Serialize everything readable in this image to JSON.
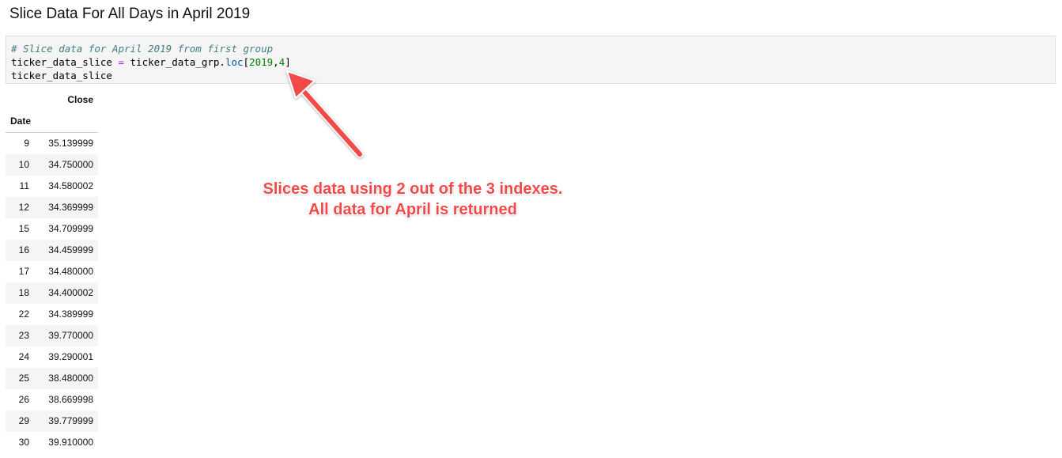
{
  "heading": "Slice Data For All Days in April 2019",
  "code": {
    "line1_comment": "# Slice data for April 2019 from first group",
    "line2": {
      "var": "ticker_data_slice ",
      "op": "=",
      "obj": " ticker_data_grp.",
      "fn": "loc",
      "open": "[",
      "num1": "2019",
      "comma": ",",
      "num2": "4",
      "close": "]"
    },
    "line3": "ticker_data_slice"
  },
  "table": {
    "column_header": "Close",
    "index_header": "Date",
    "rows": [
      {
        "idx": "9",
        "val": "35.139999"
      },
      {
        "idx": "10",
        "val": "34.750000"
      },
      {
        "idx": "11",
        "val": "34.580002"
      },
      {
        "idx": "12",
        "val": "34.369999"
      },
      {
        "idx": "15",
        "val": "34.709999"
      },
      {
        "idx": "16",
        "val": "34.459999"
      },
      {
        "idx": "17",
        "val": "34.480000"
      },
      {
        "idx": "18",
        "val": "34.400002"
      },
      {
        "idx": "22",
        "val": "34.389999"
      },
      {
        "idx": "23",
        "val": "39.770000"
      },
      {
        "idx": "24",
        "val": "39.290001"
      },
      {
        "idx": "25",
        "val": "38.480000"
      },
      {
        "idx": "26",
        "val": "38.669998"
      },
      {
        "idx": "29",
        "val": "39.779999"
      },
      {
        "idx": "30",
        "val": "39.910000"
      }
    ]
  },
  "annotation": {
    "line1": "Slices data using 2 out of the 3 indexes.",
    "line2": "All data for April is returned",
    "color": "#f24a4a"
  },
  "colors": {
    "comment": "#408080",
    "operator": "#aa22ff",
    "function": "#0055aa",
    "number": "#008000",
    "code_bg": "#f5f5f5"
  }
}
